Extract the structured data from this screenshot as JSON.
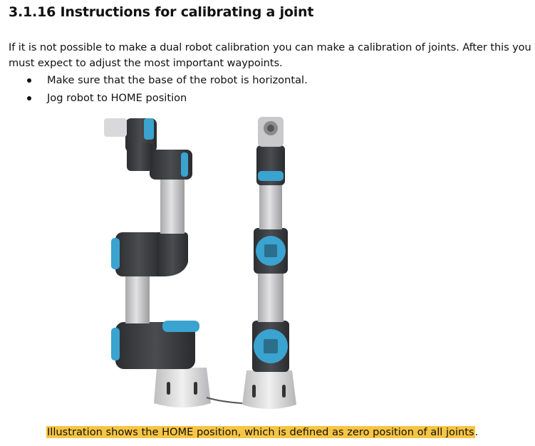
{
  "section": {
    "number": "3.1.16",
    "title": "Instructions for calibrating a joint"
  },
  "paragraph": "If it is not possible to make a dual robot calibration you can make a calibration of joints. After this you must expect to adjust the most important waypoints.",
  "bullets": [
    "Make sure that the base of the robot is horizontal.",
    "Jog robot to HOME position"
  ],
  "figure": {
    "colors": {
      "accent": "#3aa3d0",
      "joint_dark": "#3b3d40",
      "link_gray": "#c9c9cb",
      "base_light": "#e6e6e6"
    }
  },
  "caption": {
    "highlighted": "Illustration shows the HOME position, which is defined as zero position of all joints",
    "tail": "."
  }
}
